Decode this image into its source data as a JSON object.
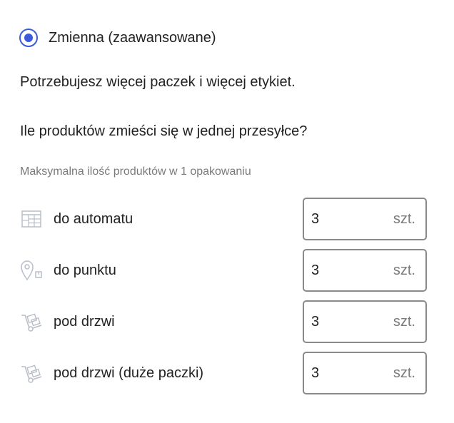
{
  "option": {
    "label": "Zmienna (zaawansowane)",
    "selected": true
  },
  "description": "Potrzebujesz więcej paczek i więcej etykiet.",
  "question": "Ile produktów zmieści się w jednej przesyłce?",
  "caption": "Maksymalna ilość produktów w 1 opakowaniu",
  "rows": [
    {
      "label": "do automatu",
      "icon": "parcel-locker-icon",
      "value": "3",
      "unit": "szt."
    },
    {
      "label": "do punktu",
      "icon": "pickup-point-icon",
      "value": "3",
      "unit": "szt."
    },
    {
      "label": "pod drzwi",
      "icon": "courier-hand-truck-icon",
      "value": "3",
      "unit": "szt."
    },
    {
      "label": "pod drzwi (duże paczki)",
      "icon": "courier-hand-truck-icon",
      "value": "3",
      "unit": "szt."
    }
  ],
  "colors": {
    "accent": "#3b5bdb",
    "text": "#222222",
    "muted": "#7a7a7a",
    "border": "#8a8a8a"
  }
}
